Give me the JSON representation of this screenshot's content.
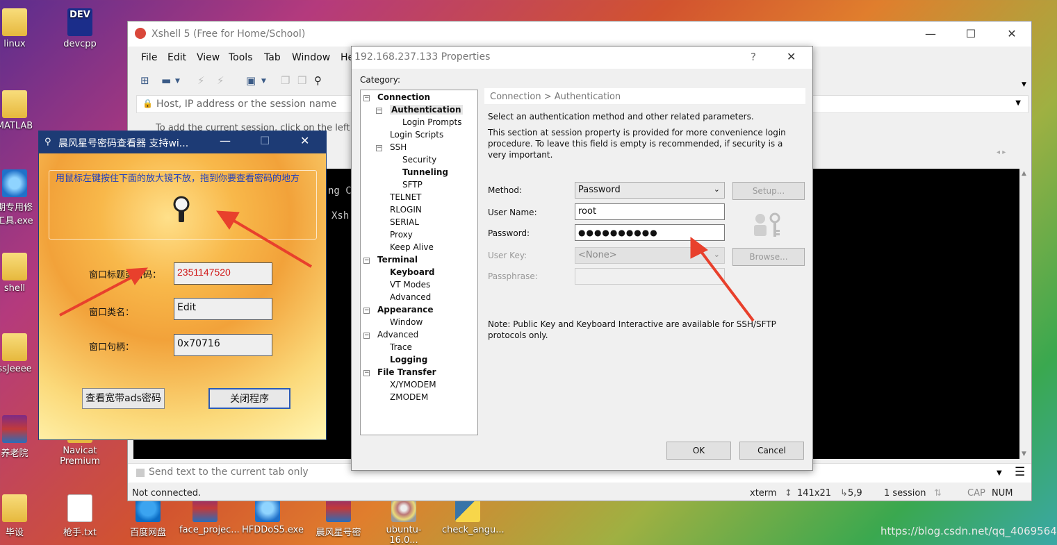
{
  "desktop": {
    "icons": [
      {
        "label": "linux",
        "icon": "folder-icon"
      },
      {
        "label": "devcpp",
        "icon": "devcpp-icon"
      },
      {
        "label": "MATLAB",
        "icon": "folder-icon"
      },
      {
        "label": "期专用修\n工具.exe",
        "icon": "app-icon"
      },
      {
        "label": "shell",
        "icon": "folder-icon"
      },
      {
        "label": "ssJeeee",
        "icon": "folder-icon"
      },
      {
        "label": "养老院",
        "icon": "rar-icon"
      },
      {
        "label": "Navicat\nPremium",
        "icon": "navicat-icon"
      },
      {
        "label": "毕设",
        "icon": "folder-icon"
      },
      {
        "label": "枪手.txt",
        "icon": "text-file-icon"
      },
      {
        "label": "百度网盘",
        "icon": "baidu-netdisk-icon"
      },
      {
        "label": "face_projec...",
        "icon": "rar-icon"
      },
      {
        "label": "HFDDoS5.exe",
        "icon": "app-icon"
      },
      {
        "label": "晨风星号密",
        "icon": "rar-icon"
      },
      {
        "label": "ubuntu-16.0...",
        "icon": "disc-icon"
      },
      {
        "label": "check_angu...",
        "icon": "python-icon"
      }
    ],
    "watermark": "https://blog.csdn.net/qq_40695642"
  },
  "xshell": {
    "title": "Xshell 5 (Free for Home/School)",
    "menu": [
      "File",
      "Edit",
      "View",
      "Tools",
      "Tab",
      "Window",
      "He"
    ],
    "address_placeholder": "Host, IP address or the session name",
    "hint": "To add the current session, click on the left",
    "terminal_lines": [
      "ng Co",
      "Xsh"
    ],
    "send_text": "Send text to the current tab only",
    "status": {
      "connection": "Not connected.",
      "term": "xterm",
      "size": "141x21",
      "cursor": "5,9",
      "sessions": "1 session",
      "cap": "CAP",
      "num": "NUM"
    }
  },
  "properties": {
    "title": "192.168.237.133 Properties",
    "help": "?",
    "category_label": "Category:",
    "tree": [
      {
        "label": "Connection",
        "bold": true,
        "level": 0,
        "toggle": "-"
      },
      {
        "label": "Authentication",
        "bold": true,
        "level": 1,
        "toggle": "-",
        "selected": true
      },
      {
        "label": "Login Prompts",
        "bold": false,
        "level": 2
      },
      {
        "label": "Login Scripts",
        "bold": false,
        "level": 1
      },
      {
        "label": "SSH",
        "bold": false,
        "level": 1,
        "toggle": "-"
      },
      {
        "label": "Security",
        "bold": false,
        "level": 2
      },
      {
        "label": "Tunneling",
        "bold": true,
        "level": 2
      },
      {
        "label": "SFTP",
        "bold": false,
        "level": 2
      },
      {
        "label": "TELNET",
        "bold": false,
        "level": 1
      },
      {
        "label": "RLOGIN",
        "bold": false,
        "level": 1
      },
      {
        "label": "SERIAL",
        "bold": false,
        "level": 1
      },
      {
        "label": "Proxy",
        "bold": false,
        "level": 1
      },
      {
        "label": "Keep Alive",
        "bold": false,
        "level": 1
      },
      {
        "label": "Terminal",
        "bold": true,
        "level": 0,
        "toggle": "-"
      },
      {
        "label": "Keyboard",
        "bold": true,
        "level": 1
      },
      {
        "label": "VT Modes",
        "bold": false,
        "level": 1
      },
      {
        "label": "Advanced",
        "bold": false,
        "level": 1
      },
      {
        "label": "Appearance",
        "bold": true,
        "level": 0,
        "toggle": "-"
      },
      {
        "label": "Window",
        "bold": false,
        "level": 1
      },
      {
        "label": "Advanced",
        "bold": false,
        "level": 0,
        "toggle": "-"
      },
      {
        "label": "Trace",
        "bold": false,
        "level": 1
      },
      {
        "label": "Logging",
        "bold": true,
        "level": 1
      },
      {
        "label": "File Transfer",
        "bold": true,
        "level": 0,
        "toggle": "-"
      },
      {
        "label": "X/YMODEM",
        "bold": false,
        "level": 1
      },
      {
        "label": "ZMODEM",
        "bold": false,
        "level": 1
      }
    ],
    "breadcrumb": "Connection > Authentication",
    "intro": "Select an authentication method and other related parameters.",
    "desc": "This section at session property is provided for more convenience login procedure. To leave this field is empty is recommended, if security is a very important.",
    "method_label": "Method:",
    "method_value": "Password",
    "setup_button": "Setup...",
    "username_label": "User Name:",
    "username_value": "root",
    "password_label": "Password:",
    "password_value": "●●●●●●●●●●",
    "userkey_label": "User Key:",
    "userkey_value": "<None>",
    "browse_button": "Browse...",
    "passphrase_label": "Passphrase:",
    "note": "Note: Public Key and Keyboard Interactive are available for SSH/SFTP protocols only.",
    "ok_button": "OK",
    "cancel_button": "Cancel"
  },
  "viewer": {
    "title": "晨风星号密码查看器 支持wi...",
    "tip": "用鼠标左键按住下面的放大镜不放，拖到你要查看密码的地方",
    "title_pwd_label": "窗口标题或密码：",
    "title_pwd_value": "2351147520",
    "class_label": "窗口类名：",
    "class_value": "Edit",
    "handle_label": "窗口句柄：",
    "handle_value": "0x70716",
    "view_button": "查看宽带ads密码",
    "close_button": "关闭程序",
    "value_color": "#d01818",
    "tip_color": "#1f3fbf"
  },
  "annotations": {
    "arrow_color": "#e8402c"
  }
}
